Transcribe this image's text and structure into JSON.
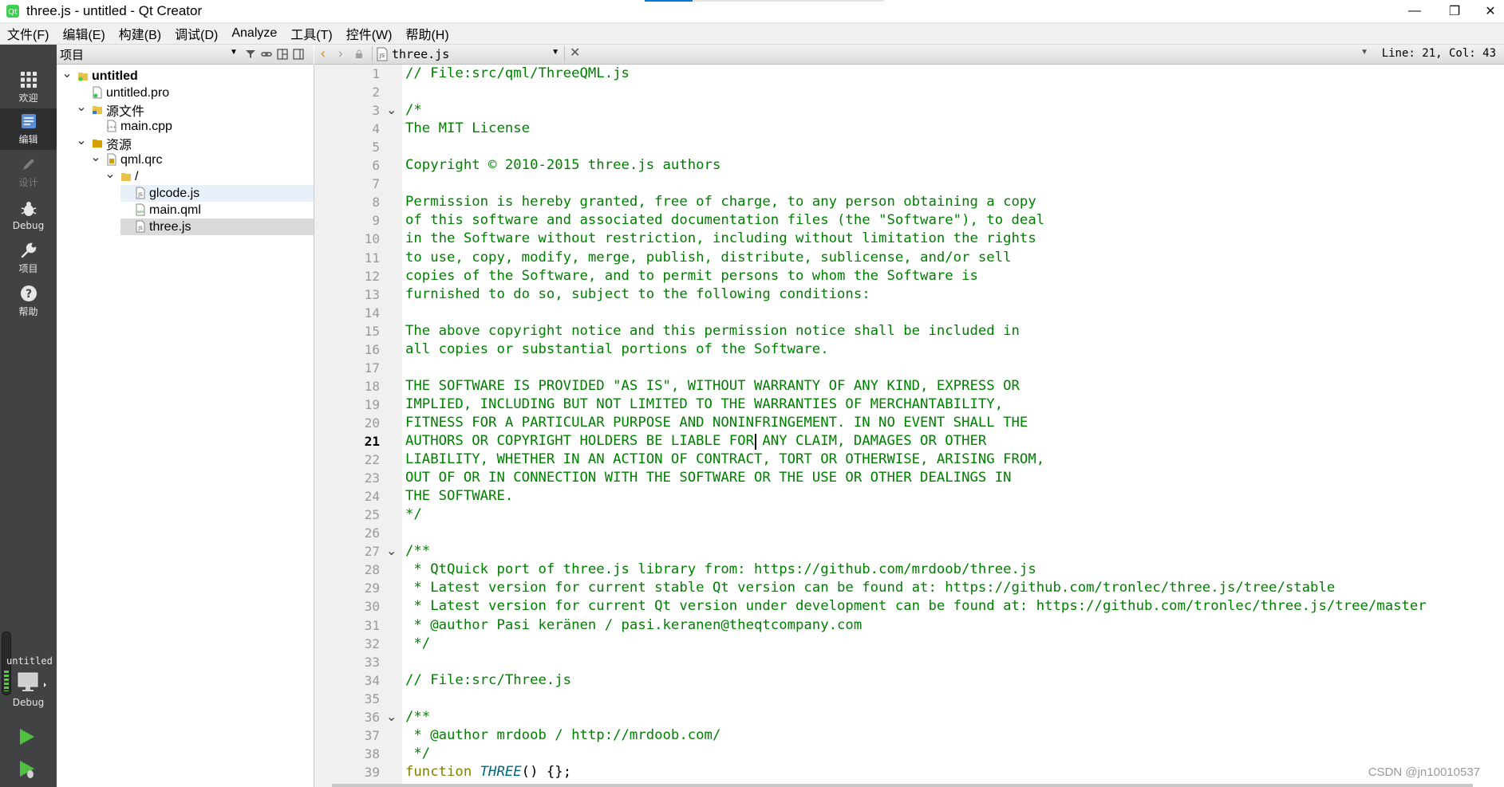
{
  "window": {
    "title": "three.js - untitled - Qt Creator",
    "minimize": "—",
    "restore": "❐",
    "close": "✕"
  },
  "menu": [
    "文件(F)",
    "编辑(E)",
    "构建(B)",
    "调试(D)",
    "Analyze",
    "工具(T)",
    "控件(W)",
    "帮助(H)"
  ],
  "modes": [
    {
      "label": "欢迎",
      "icon": "grid-icon"
    },
    {
      "label": "编辑",
      "icon": "edit-icon",
      "active": true
    },
    {
      "label": "设计",
      "icon": "pencil-icon",
      "disabled": true
    },
    {
      "label": "Debug",
      "icon": "bug-icon"
    },
    {
      "label": "项目",
      "icon": "wrench-icon"
    },
    {
      "label": "帮助",
      "icon": "help-icon"
    }
  ],
  "kit": {
    "project": "untitled",
    "config": "Debug"
  },
  "project_panel": {
    "title": "项目",
    "tree": [
      {
        "label": "untitled",
        "depth": 0,
        "arrow": "open",
        "icon": "project-icon",
        "bold": true
      },
      {
        "label": "untitled.pro",
        "depth": 1,
        "arrow": "",
        "icon": "pro-file-icon"
      },
      {
        "label": "源文件",
        "depth": 1,
        "arrow": "open",
        "icon": "folder-cpp-icon"
      },
      {
        "label": "main.cpp",
        "depth": 2,
        "arrow": "",
        "icon": "cpp-file-icon"
      },
      {
        "label": "资源",
        "depth": 1,
        "arrow": "open",
        "icon": "folder-res-icon"
      },
      {
        "label": "qml.qrc",
        "depth": 2,
        "arrow": "open",
        "icon": "qrc-file-icon"
      },
      {
        "label": "/",
        "depth": 3,
        "arrow": "open",
        "icon": "folder-icon"
      },
      {
        "label": "glcode.js",
        "depth": 4,
        "arrow": "",
        "icon": "js-file-icon",
        "state": "hl"
      },
      {
        "label": "main.qml",
        "depth": 4,
        "arrow": "",
        "icon": "qml-file-icon"
      },
      {
        "label": "three.js",
        "depth": 4,
        "arrow": "",
        "icon": "js-file-icon",
        "state": "sel"
      }
    ]
  },
  "editor": {
    "file_name": "three.js",
    "position": "Line: 21, Col: 43",
    "current_line": 21,
    "folds": [
      3,
      27,
      36
    ],
    "lines": [
      "// File:src/qml/ThreeQML.js",
      "",
      "/*",
      "The MIT License",
      "",
      "Copyright © 2010-2015 three.js authors",
      "",
      "Permission is hereby granted, free of charge, to any person obtaining a copy",
      "of this software and associated documentation files (the \"Software\"), to deal",
      "in the Software without restriction, including without limitation the rights",
      "to use, copy, modify, merge, publish, distribute, sublicense, and/or sell",
      "copies of the Software, and to permit persons to whom the Software is",
      "furnished to do so, subject to the following conditions:",
      "",
      "The above copyright notice and this permission notice shall be included in",
      "all copies or substantial portions of the Software.",
      "",
      "THE SOFTWARE IS PROVIDED \"AS IS\", WITHOUT WARRANTY OF ANY KIND, EXPRESS OR",
      "IMPLIED, INCLUDING BUT NOT LIMITED TO THE WARRANTIES OF MERCHANTABILITY,",
      "FITNESS FOR A PARTICULAR PURPOSE AND NONINFRINGEMENT. IN NO EVENT SHALL THE",
      "AUTHORS OR COPYRIGHT HOLDERS BE LIABLE FOR ANY CLAIM, DAMAGES OR OTHER",
      "LIABILITY, WHETHER IN AN ACTION OF CONTRACT, TORT OR OTHERWISE, ARISING FROM,",
      "OUT OF OR IN CONNECTION WITH THE SOFTWARE OR THE USE OR OTHER DEALINGS IN",
      "THE SOFTWARE.",
      "*/",
      "",
      "/**",
      " * QtQuick port of three.js library from: https://github.com/mrdoob/three.js",
      " * Latest version for current stable Qt version can be found at: https://github.com/tronlec/three.js/tree/stable",
      " * Latest version for current Qt version under development can be found at: https://github.com/tronlec/three.js/tree/master",
      " * @author Pasi keränen / pasi.keranen@theqtcompany.com",
      " */",
      "",
      "// File:src/Three.js",
      "",
      "/**",
      " * @author mrdoob / http://mrdoob.com/",
      " */",
      "function THREE() {};"
    ],
    "last_line": {
      "keyword": "function",
      "name": "THREE",
      "rest": "() {};"
    }
  },
  "watermark": "CSDN @jn10010537",
  "colors": {
    "comment": "#008000",
    "keyword": "#808000",
    "function": "#00677c",
    "sidebar": "#404244"
  }
}
